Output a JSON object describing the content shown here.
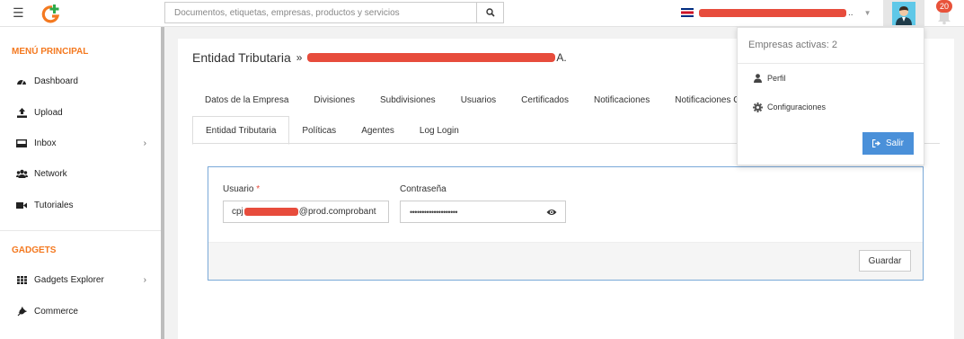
{
  "topbar": {
    "search_placeholder": "Documentos, etiquetas, empresas, productos y servicios",
    "company_ellipsis": "..",
    "notifications_count": "20"
  },
  "sidebar": {
    "main_heading": "MENÚ PRINCIPAL",
    "main_items": [
      {
        "label": "Dashboard",
        "icon": "dashboard-icon"
      },
      {
        "label": "Upload",
        "icon": "upload-icon"
      },
      {
        "label": "Inbox",
        "icon": "inbox-icon",
        "has_submenu": true
      },
      {
        "label": "Network",
        "icon": "network-icon"
      },
      {
        "label": "Tutoriales",
        "icon": "video-icon"
      }
    ],
    "gadgets_heading": "GADGETS",
    "gadget_items": [
      {
        "label": "Gadgets Explorer",
        "icon": "grid-icon",
        "has_submenu": true
      },
      {
        "label": "Commerce",
        "icon": "plug-icon"
      }
    ]
  },
  "page": {
    "title": "Entidad Tributaria",
    "title_separator": "»",
    "title_suffix": "A.",
    "tabs_row1": [
      "Datos de la Empresa",
      "Divisiones",
      "Subdivisiones",
      "Usuarios",
      "Certificados",
      "Notificaciones",
      "Notificaciones C"
    ],
    "tabs_row2": [
      "Entidad Tributaria",
      "Políticas",
      "Agentes",
      "Log Login"
    ],
    "active_tab": "Entidad Tributaria"
  },
  "form": {
    "user_label": "Usuario",
    "required_mark": "*",
    "user_prefix": "cpj",
    "user_suffix": "@prod.comprobant",
    "password_label": "Contraseña",
    "password_value": "••••••••••••••••••••",
    "save_label": "Guardar"
  },
  "dropdown": {
    "header": "Empresas activas: 2",
    "profile_label": "Perfil",
    "settings_label": "Configuraciones",
    "logout_label": "Salir"
  },
  "colors": {
    "accent_orange": "#f47920",
    "primary_blue": "#4a90d9",
    "badge_red": "#e8523a",
    "redaction_red": "#e74c3c"
  }
}
